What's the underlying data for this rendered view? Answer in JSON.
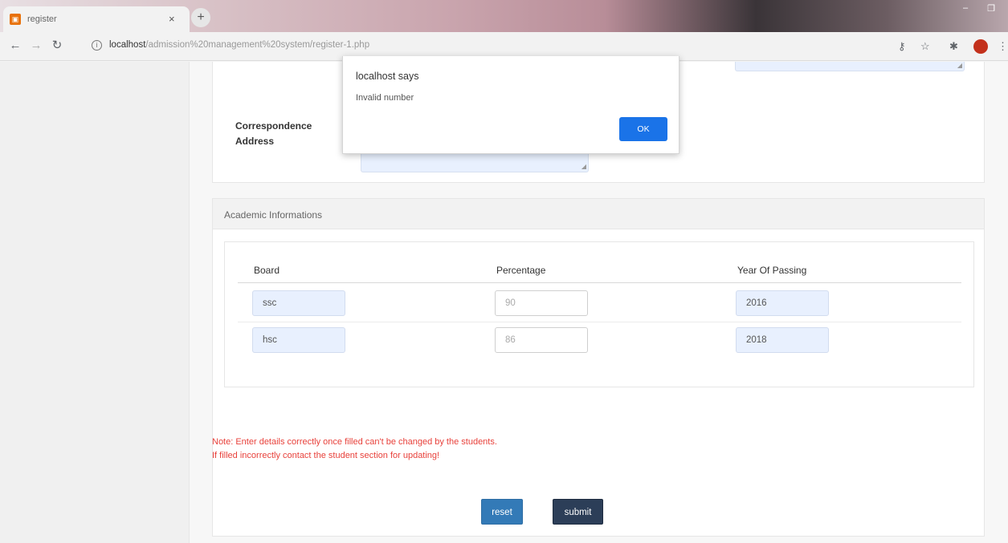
{
  "browser": {
    "tab_title": "register",
    "tab_close": "×",
    "new_tab": "+",
    "url_host": "localhost",
    "url_path": "/admission%20management%20system/register-1.php"
  },
  "form": {
    "correspondence_label_1": "Correspondence",
    "correspondence_label_2": "Address",
    "academic_title": "Academic Informations",
    "columns": [
      "Board",
      "Percentage",
      "Year Of Passing"
    ],
    "rows": [
      {
        "board": "ssc",
        "percentage": "90",
        "year": "2016"
      },
      {
        "board": "hsc",
        "percentage": "86",
        "year": "2018"
      }
    ],
    "note_line_1": "Note: Enter details correctly once filled can't be changed by the students.",
    "note_line_2": "If filled incorrectly contact the student section for updating!",
    "reset_label": "reset",
    "submit_label": "submit"
  },
  "alert": {
    "origin": "localhost says",
    "message": "Invalid number",
    "ok_label": "OK"
  },
  "colors": {
    "note": "#e8413b",
    "reset": "#337ab7",
    "submit": "#2c3e58",
    "alert_ok": "#1a73e8",
    "autofill": "#e8f0fe"
  }
}
